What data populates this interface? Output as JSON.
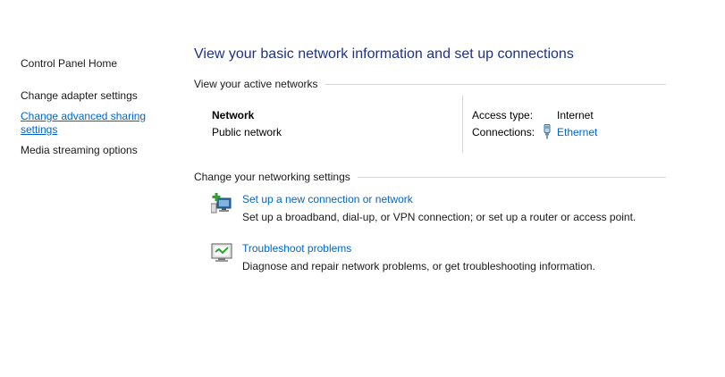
{
  "nav": {
    "home": "Control Panel Home",
    "adapter": "Change adapter settings",
    "sharing": "Change advanced sharing settings",
    "media": "Media streaming options"
  },
  "main": {
    "title": "View your basic network information and set up connections",
    "active_header": "View your active networks",
    "network": {
      "name": "Network",
      "type": "Public network",
      "access_label": "Access type:",
      "access_value": "Internet",
      "connections_label": "Connections:",
      "connections_value": "Ethernet"
    },
    "change_header": "Change your networking settings",
    "tasks": [
      {
        "icon": "new-connection-icon",
        "link": "Set up a new connection or network",
        "desc": "Set up a broadband, dial-up, or VPN connection; or set up a router or access point."
      },
      {
        "icon": "troubleshoot-icon",
        "link": "Troubleshoot problems",
        "desc": "Diagnose and repair network problems, or get troubleshooting information."
      }
    ]
  },
  "colors": {
    "link": "#0066cc",
    "title": "#1e3287",
    "divider": "#d6d6d6"
  }
}
